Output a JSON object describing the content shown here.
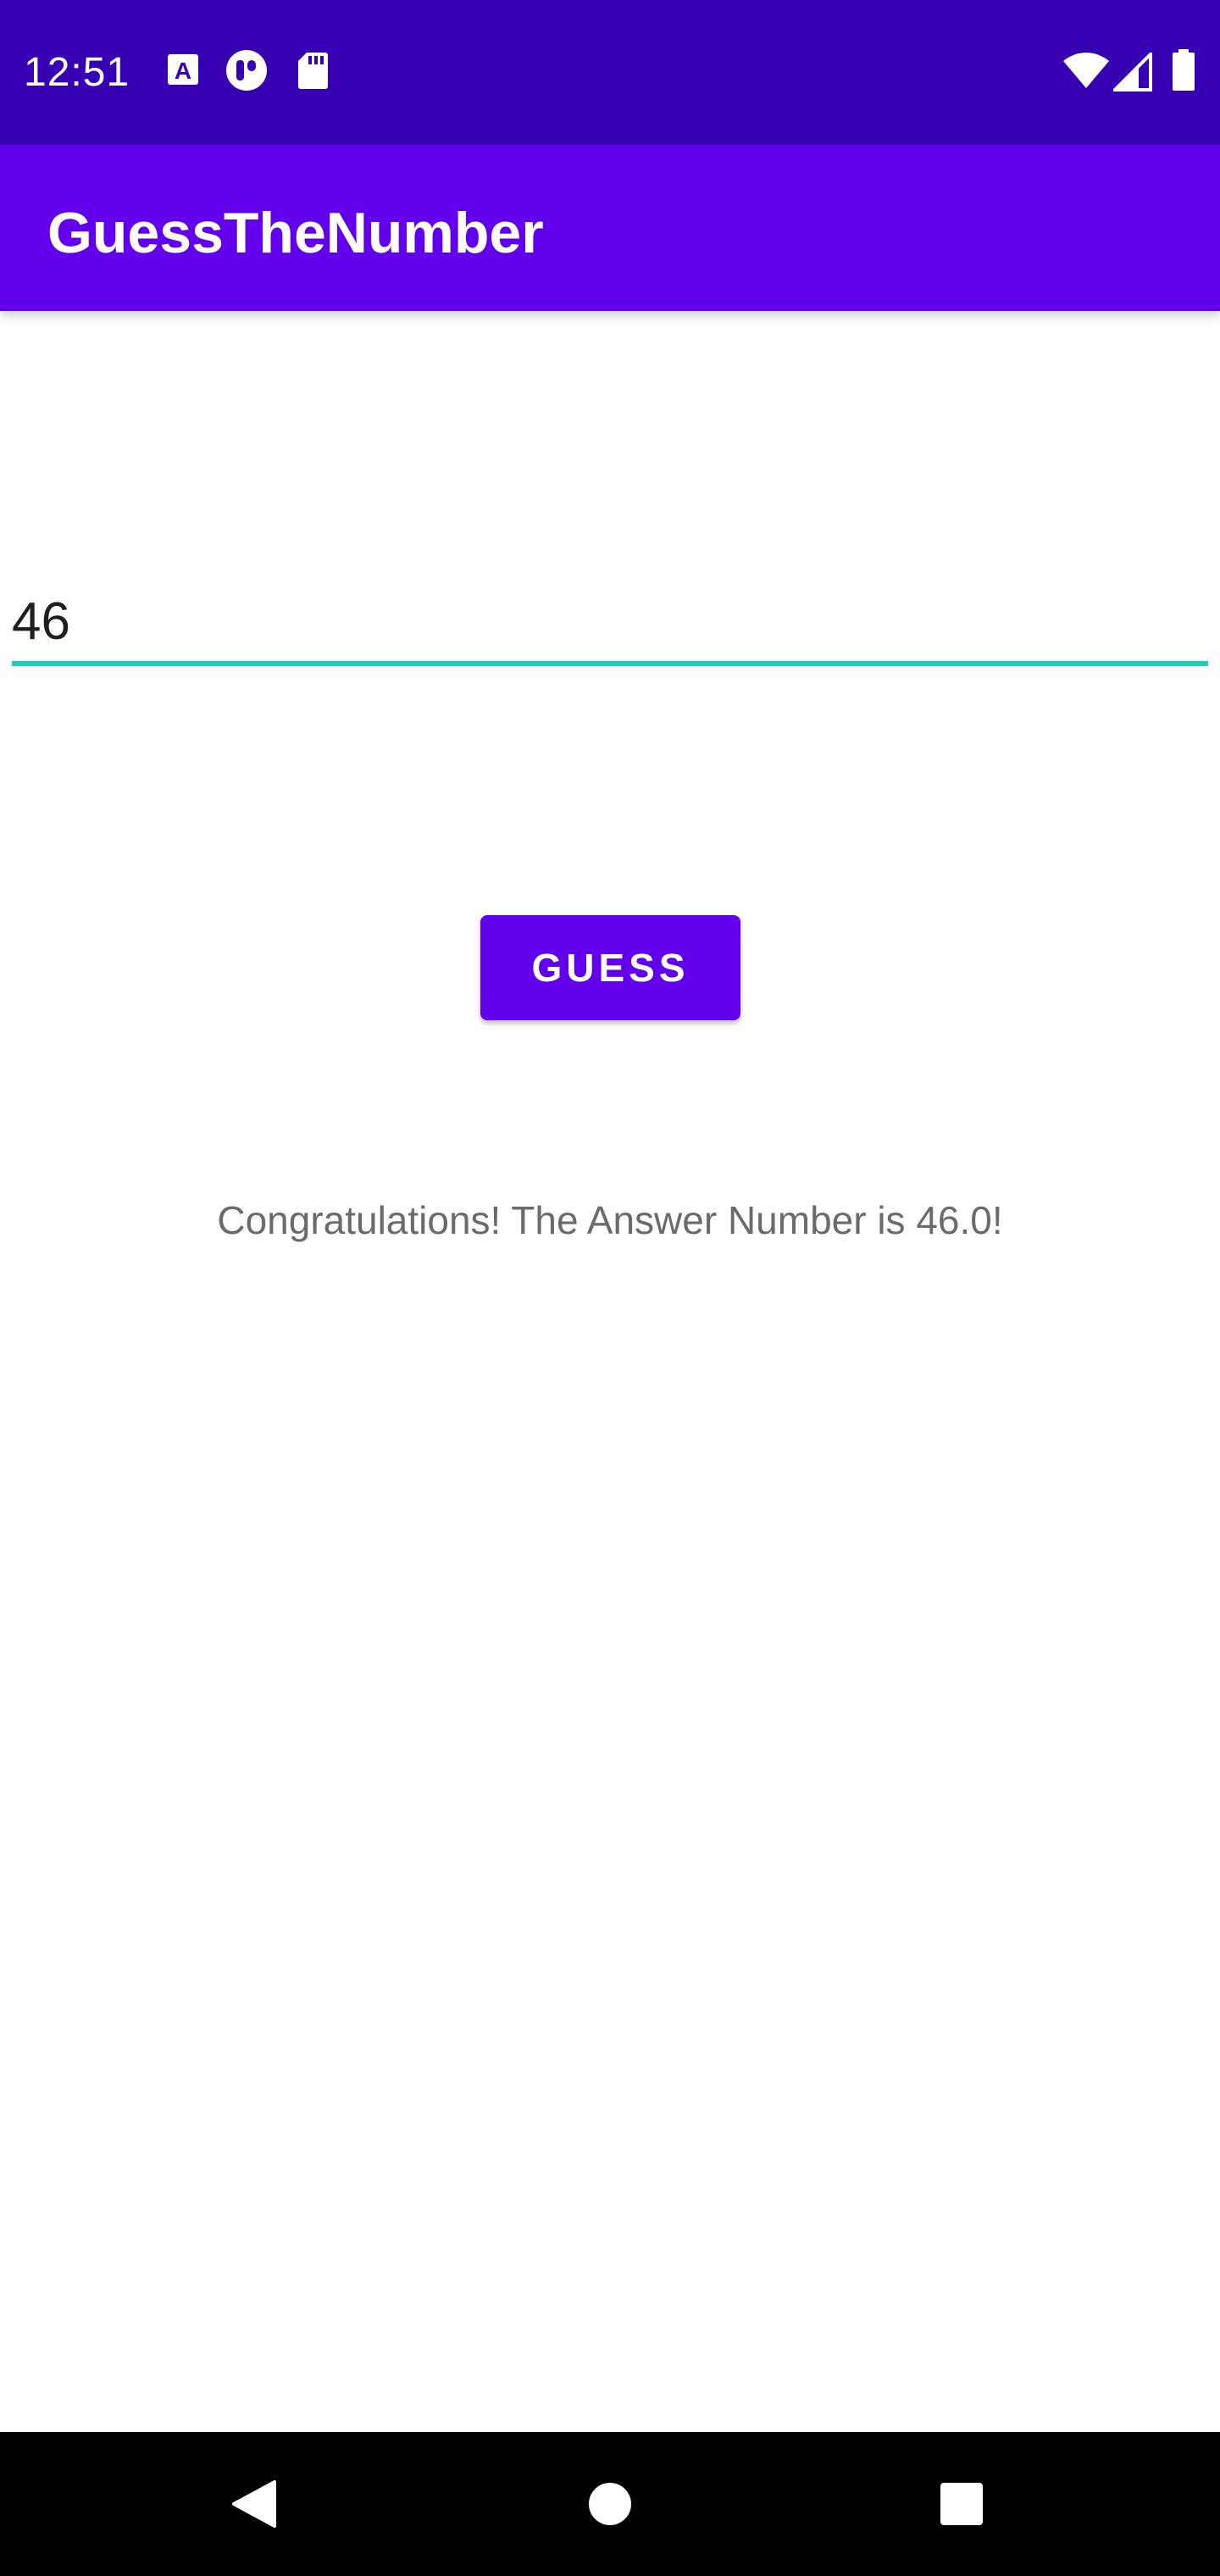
{
  "status_bar": {
    "time": "12:51",
    "icons": [
      "text-a-icon",
      "app-notification-icon",
      "sd-card-icon",
      "wifi-icon",
      "cell-signal-icon",
      "battery-icon"
    ],
    "background": "#3700b3"
  },
  "app_bar": {
    "title": "GuessTheNumber",
    "background": "#6200ee"
  },
  "number_field": {
    "value": "46",
    "underline_color": "#1fcdb8"
  },
  "guess_button": {
    "label": "GUESS",
    "background": "#6200ee"
  },
  "result": {
    "text": "Congratulations! The Answer Number is 46.0!"
  },
  "nav_bar": {
    "buttons": [
      "back-icon",
      "home-icon",
      "recents-icon"
    ]
  }
}
